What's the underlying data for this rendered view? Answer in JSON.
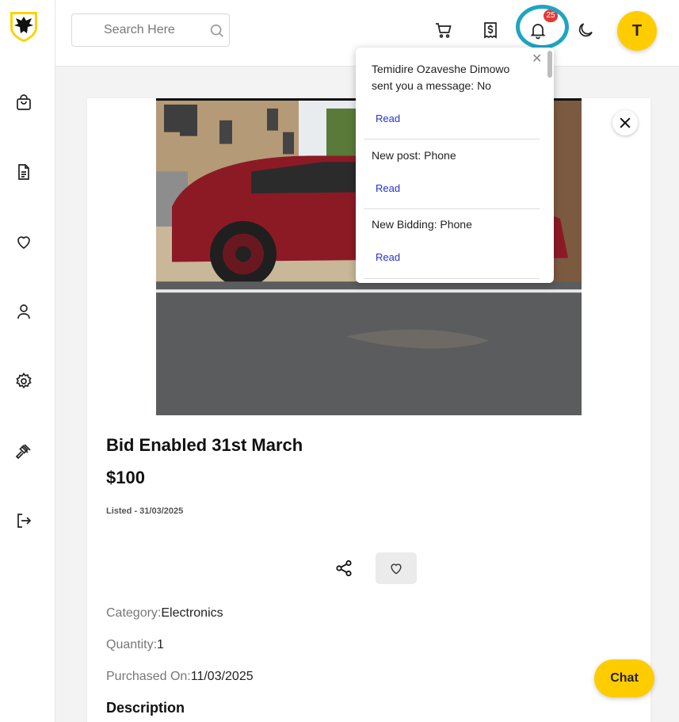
{
  "header": {
    "search_placeholder": "Search Here",
    "notification_count": "25",
    "avatar_initial": "T"
  },
  "sidebar": {
    "items": [
      "bag-icon",
      "document-icon",
      "heart-icon",
      "user-icon",
      "gear-icon",
      "gavel-icon",
      "logout-icon"
    ]
  },
  "listing": {
    "title": "Bid Enabled 31st March",
    "price": "$100",
    "listed": "Listed - 31/03/2025",
    "category_label": "Category:",
    "category_value": "Electronics",
    "quantity_label": "Quantity:",
    "quantity_value": "1",
    "purchased_label": "Purchased On:",
    "purchased_value": "11/03/2025",
    "description_heading": "Description"
  },
  "notifications": {
    "items": [
      {
        "message": "Temidire Ozaveshe Dimowo sent you a message: No",
        "action": "Read"
      },
      {
        "message": "New post: Phone",
        "action": "Read"
      },
      {
        "message": "New Bidding: Phone",
        "action": "Read"
      }
    ]
  },
  "chat": {
    "label": "Chat"
  },
  "colors": {
    "accent": "#ffcc00",
    "badge": "#e53935",
    "highlight": "#1ea5c3",
    "link": "#2233cc"
  }
}
